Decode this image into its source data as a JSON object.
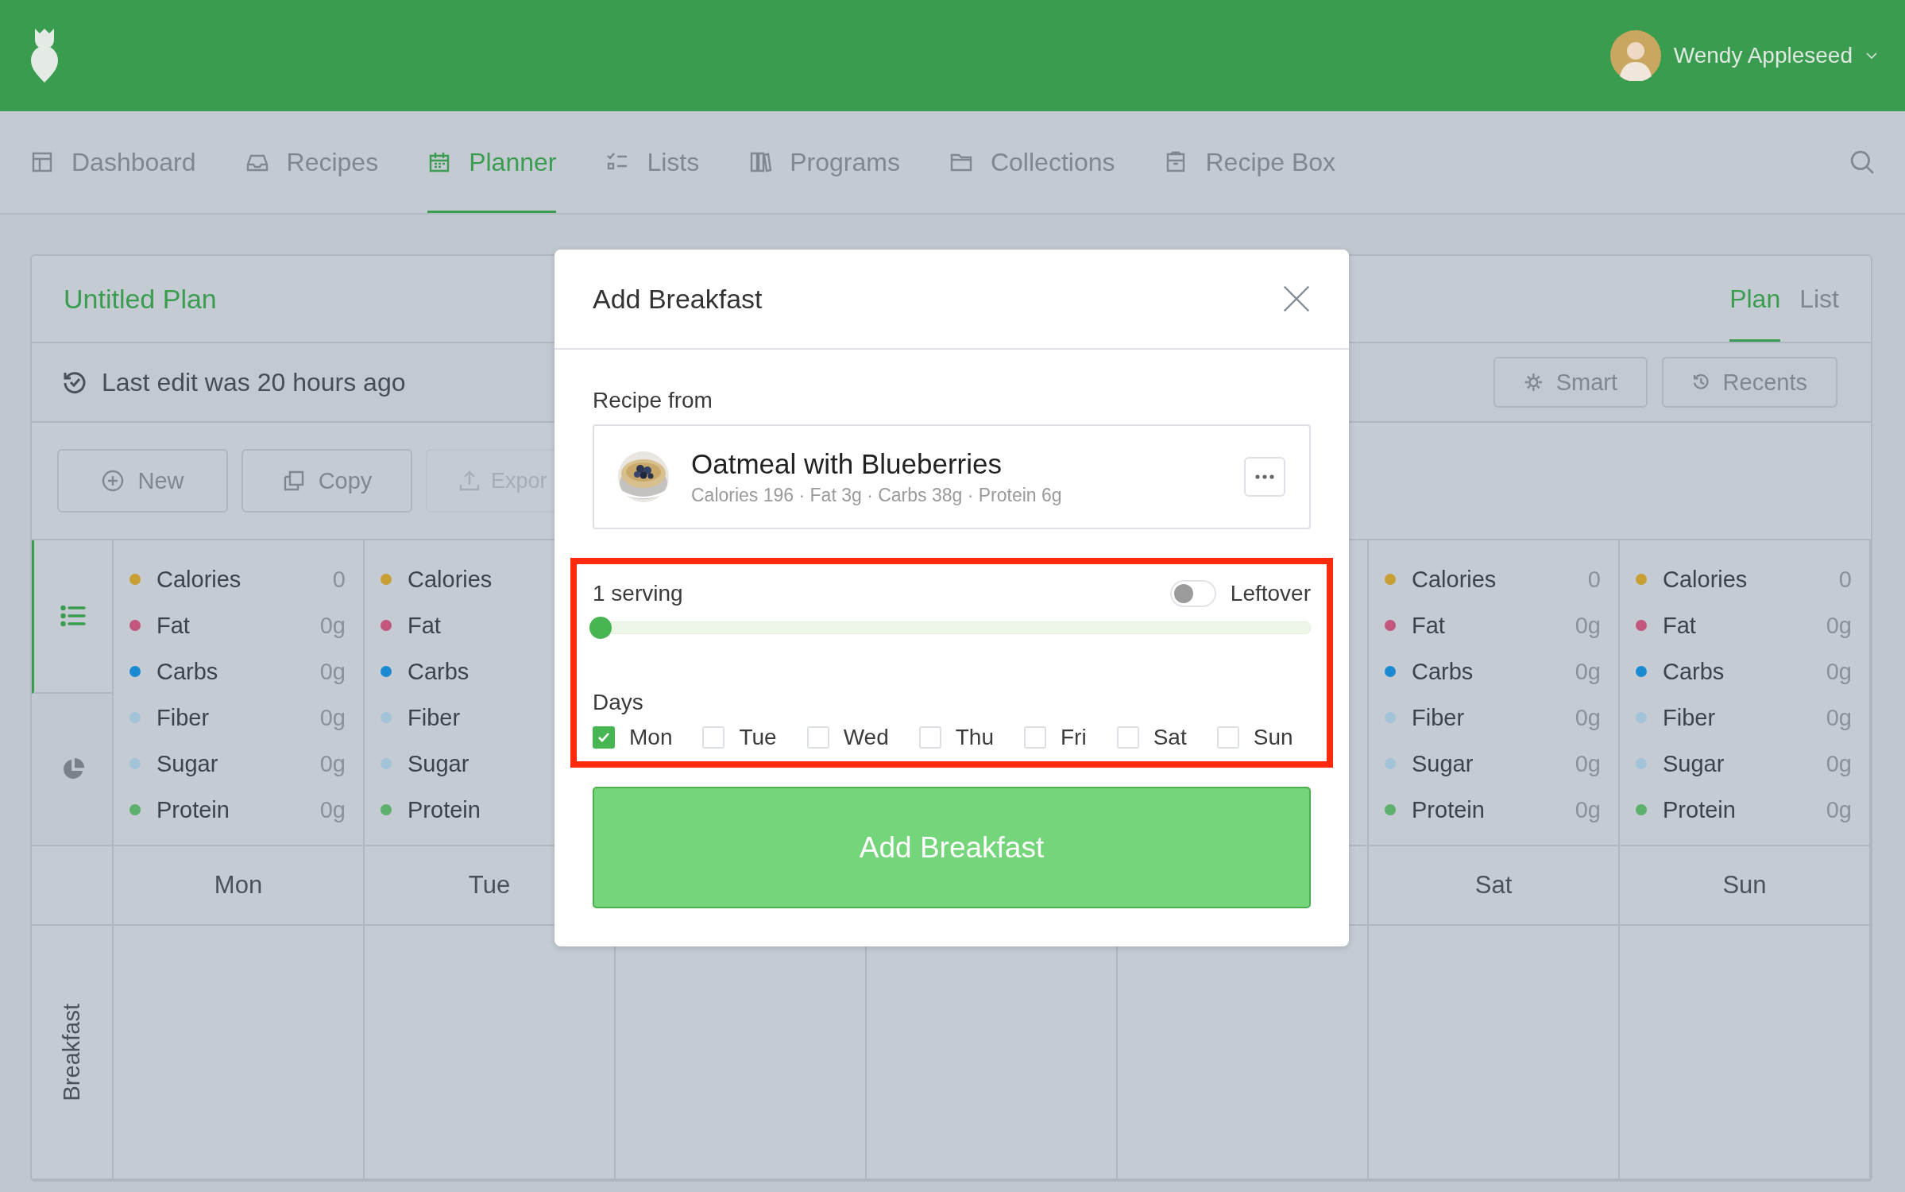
{
  "header": {
    "user": {
      "name": "Wendy Appleseed"
    }
  },
  "nav": [
    {
      "label": "Dashboard",
      "selected": false
    },
    {
      "label": "Recipes",
      "selected": false
    },
    {
      "label": "Planner",
      "selected": true
    },
    {
      "label": "Lists",
      "selected": false
    },
    {
      "label": "Programs",
      "selected": false
    },
    {
      "label": "Collections",
      "selected": false
    },
    {
      "label": "Recipe Box",
      "selected": false
    }
  ],
  "plan": {
    "title": "Untitled Plan",
    "views": [
      {
        "label": "Plan",
        "selected": true
      },
      {
        "label": "List",
        "selected": false
      }
    ],
    "last_edit": "Last edit was 20 hours ago",
    "tools": [
      "Smart",
      "Recents"
    ],
    "actions": [
      "New",
      "Copy",
      "Expor"
    ],
    "summary_tabs": [
      {
        "selected": true
      },
      {
        "selected": false
      }
    ],
    "days_left": [
      {
        "name": "Mon",
        "nutrients": [
          {
            "label": "Calories",
            "value": "0",
            "color": "#c89f35"
          },
          {
            "label": "Fat",
            "value": "0g",
            "color": "#c2567f"
          },
          {
            "label": "Carbs",
            "value": "0g",
            "color": "#1b8ad2"
          },
          {
            "label": "Fiber",
            "value": "0g",
            "color": "#a3c3d8"
          },
          {
            "label": "Sugar",
            "value": "0g",
            "color": "#a3c3d8"
          },
          {
            "label": "Protein",
            "value": "0g",
            "color": "#5db06b"
          }
        ]
      },
      {
        "name": "Tue",
        "nutrients": [
          {
            "label": "Calories",
            "color": "#c89f35"
          },
          {
            "label": "Fat",
            "color": "#c2567f"
          },
          {
            "label": "Carbs",
            "color": "#1b8ad2"
          },
          {
            "label": "Fiber",
            "color": "#a3c3d8"
          },
          {
            "label": "Sugar",
            "color": "#a3c3d8"
          },
          {
            "label": "Protein",
            "color": "#5db06b"
          }
        ]
      }
    ],
    "days_right": [
      {
        "name": "Sat",
        "nutrients": [
          {
            "label": "Calories",
            "value": "0",
            "color": "#c89f35"
          },
          {
            "label": "Fat",
            "value": "0g",
            "color": "#c2567f"
          },
          {
            "label": "Carbs",
            "value": "0g",
            "color": "#1b8ad2"
          },
          {
            "label": "Fiber",
            "value": "0g",
            "color": "#a3c3d8"
          },
          {
            "label": "Sugar",
            "value": "0g",
            "color": "#a3c3d8"
          },
          {
            "label": "Protein",
            "value": "0g",
            "color": "#5db06b"
          }
        ]
      },
      {
        "name": "Sun",
        "nutrients": [
          {
            "label": "Calories",
            "value": "0",
            "color": "#c89f35"
          },
          {
            "label": "Fat",
            "value": "0g",
            "color": "#c2567f"
          },
          {
            "label": "Carbs",
            "value": "0g",
            "color": "#1b8ad2"
          },
          {
            "label": "Fiber",
            "value": "0g",
            "color": "#a3c3d8"
          },
          {
            "label": "Sugar",
            "value": "0g",
            "color": "#a3c3d8"
          },
          {
            "label": "Protein",
            "value": "0g",
            "color": "#5db06b"
          }
        ]
      }
    ],
    "meals": [
      "Breakfast"
    ]
  },
  "modal": {
    "title": "Add Breakfast",
    "recipe_label": "Recipe from",
    "recipe": {
      "name": "Oatmeal with Blueberries",
      "details": "Calories 196 · Fat 3g · Carbs 38g · Protein 6g"
    },
    "highlighted": true,
    "servings": {
      "label": "1 serving",
      "level": 0
    },
    "leftover": {
      "label": "Leftover",
      "on": false
    },
    "days_label": "Days",
    "days": [
      {
        "label": "Mon",
        "checked": true
      },
      {
        "label": "Tue",
        "checked": false
      },
      {
        "label": "Wed",
        "checked": false
      },
      {
        "label": "Thu",
        "checked": false
      },
      {
        "label": "Fri",
        "checked": false
      },
      {
        "label": "Sat",
        "checked": false
      },
      {
        "label": "Sun",
        "checked": false
      }
    ],
    "submit": "Add Breakfast"
  }
}
